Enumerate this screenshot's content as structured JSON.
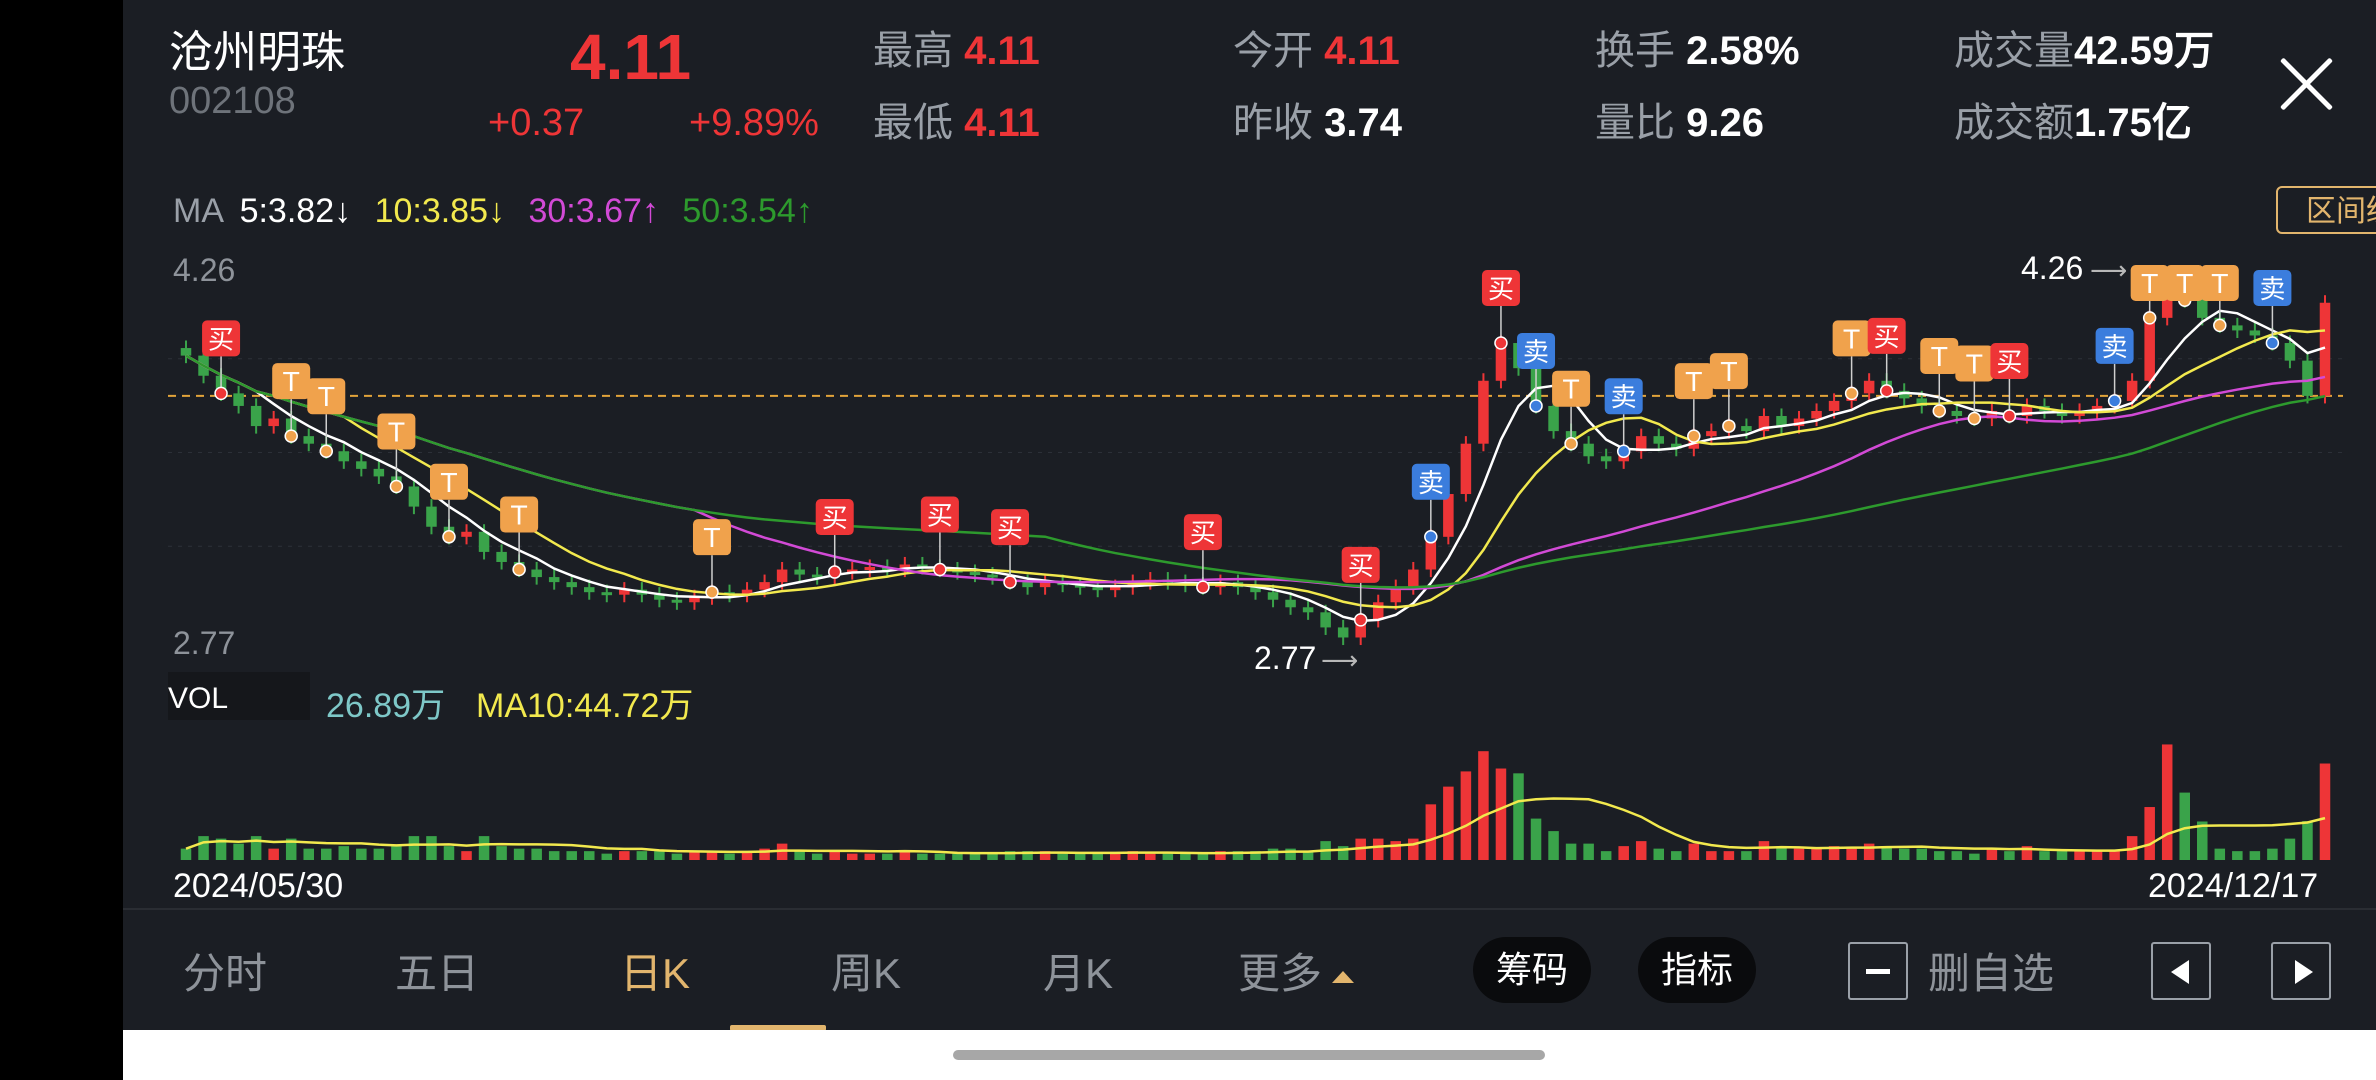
{
  "stock": {
    "name": "沧州明珠",
    "code": "002108",
    "price": "4.11",
    "change": "+0.37",
    "change_pct": "+9.89%"
  },
  "stats": {
    "high_label": "最高",
    "high_value": "4.11",
    "low_label": "最低",
    "low_value": "4.11",
    "open_label": "今开",
    "open_value": "4.11",
    "prev_close_label": "昨收",
    "prev_close_value": "3.74",
    "turnover_label": "换手",
    "turnover_value": "2.58%",
    "vol_ratio_label": "量比",
    "vol_ratio_value": "9.26",
    "volume_label": "成交量",
    "volume_value": "42.59万",
    "amount_label": "成交额",
    "amount_value": "1.75亿"
  },
  "ma_legend": {
    "label": "MA",
    "ma5": "5:3.82↓",
    "ma10": "10:3.85↓",
    "ma30": "30:3.67↑",
    "ma50": "50:3.54↑"
  },
  "range_stats_button": "区间统计",
  "price_axis": {
    "top": "4.26",
    "bottom": "2.77"
  },
  "markers": {
    "max_label": "4.26",
    "min_label": "2.77",
    "buy": "买",
    "sell": "卖",
    "t": "T"
  },
  "vol_legend": {
    "label": "VOL",
    "value": "26.89万",
    "ma10": "MA10:44.72万"
  },
  "dates": {
    "start": "2024/05/30",
    "end": "2024/12/17"
  },
  "tabs": [
    "分时",
    "五日",
    "日K",
    "周K",
    "月K",
    "更多"
  ],
  "active_tab": "日K",
  "buttons": {
    "chips": "筹码",
    "indicators": "指标",
    "remove_watchlist": "删自选"
  },
  "colors": {
    "up": "#ee3537",
    "down": "#3aa34a",
    "ma5": "#ffffff",
    "ma10": "#f2e94e",
    "ma30": "#d24ad6",
    "ma50": "#2d9a2d",
    "accent": "#e2b56d",
    "sell_tag": "#3b7ddd",
    "t_tag": "#f0a24c"
  },
  "chart_data": {
    "type": "candlestick",
    "x_range": [
      "2024/05/30",
      "2024/12/17"
    ],
    "ylim": [
      2.77,
      4.26
    ],
    "close": [
      3.9,
      3.82,
      3.75,
      3.7,
      3.62,
      3.65,
      3.58,
      3.55,
      3.52,
      3.48,
      3.45,
      3.42,
      3.38,
      3.3,
      3.22,
      3.18,
      3.2,
      3.12,
      3.08,
      3.05,
      3.02,
      3.0,
      2.98,
      2.96,
      2.95,
      2.97,
      2.95,
      2.93,
      2.92,
      2.94,
      2.96,
      2.95,
      2.97,
      3.0,
      3.05,
      3.03,
      3.02,
      3.04,
      3.05,
      3.06,
      3.05,
      3.07,
      3.06,
      3.05,
      3.04,
      3.03,
      3.02,
      3.0,
      2.98,
      3.0,
      2.99,
      2.98,
      2.97,
      2.98,
      3.0,
      3.01,
      3.0,
      2.99,
      2.98,
      3.0,
      2.98,
      2.96,
      2.93,
      2.9,
      2.88,
      2.82,
      2.78,
      2.85,
      2.92,
      2.98,
      3.05,
      3.18,
      3.35,
      3.55,
      3.8,
      3.95,
      3.85,
      3.7,
      3.6,
      3.55,
      3.5,
      3.48,
      3.52,
      3.58,
      3.55,
      3.53,
      3.58,
      3.6,
      3.62,
      3.6,
      3.66,
      3.62,
      3.65,
      3.68,
      3.72,
      3.75,
      3.8,
      3.76,
      3.73,
      3.7,
      3.68,
      3.66,
      3.65,
      3.68,
      3.66,
      3.7,
      3.68,
      3.66,
      3.68,
      3.7,
      3.72,
      3.8,
      4.05,
      4.15,
      4.12,
      4.05,
      4.02,
      4.0,
      3.98,
      3.95,
      3.88,
      3.74,
      4.11
    ],
    "volume_ma10_last": "44.72万",
    "volume_last": "26.89万"
  }
}
